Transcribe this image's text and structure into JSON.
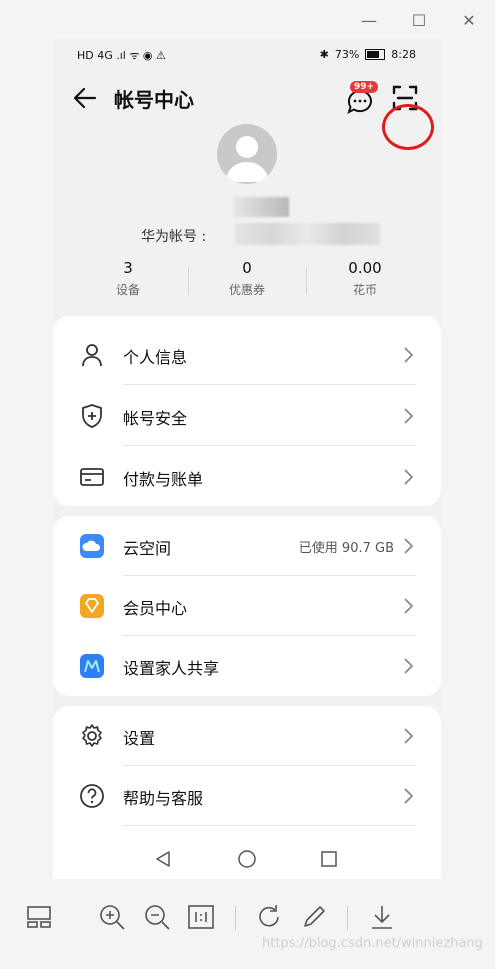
{
  "window": {
    "minimize": "—",
    "maximize": "☐",
    "close": "✕"
  },
  "status_bar": {
    "left": "HD 4G .ıl ᯤ ◉ ⚠",
    "battery": "73%",
    "time": "8:28"
  },
  "header": {
    "title": "帐号中心",
    "badge": "99+"
  },
  "profile": {
    "id_label": "华为帐号 :"
  },
  "stats": [
    {
      "value": "3",
      "label": "设备"
    },
    {
      "value": "0",
      "label": "优惠券"
    },
    {
      "value": "0.00",
      "label": "花币"
    }
  ],
  "group1": [
    {
      "label": "个人信息"
    },
    {
      "label": "帐号安全"
    },
    {
      "label": "付款与账单"
    }
  ],
  "group2": [
    {
      "label": "云空间",
      "value": "已使用 90.7 GB"
    },
    {
      "label": "会员中心"
    },
    {
      "label": "设置家人共享"
    }
  ],
  "group3": [
    {
      "label": "设置"
    },
    {
      "label": "帮助与客服"
    }
  ],
  "watermark": "https://blog.csdn.net/winniezhang",
  "colors": {
    "highlight": "#e01b1b",
    "badge": "#e53935",
    "cloud": "#3b8cf2",
    "vip": "#f5a623",
    "family": "#2f7ff0"
  }
}
